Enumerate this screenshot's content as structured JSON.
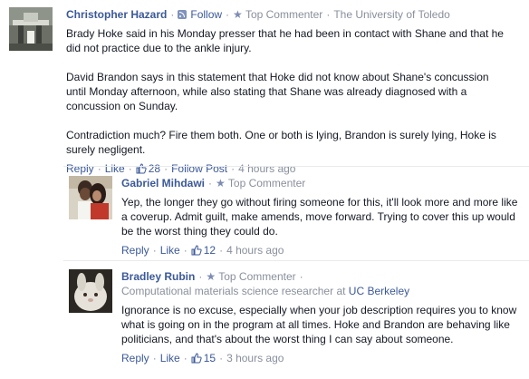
{
  "comments": [
    {
      "author": "Christopher Hazard",
      "follow_label": "Follow",
      "badge": "Top Commenter",
      "affiliation": "The University of Toledo",
      "paragraphs": [
        "Brady Hoke said in his Monday presser that he had been in contact with Shane and that he did not practice due to the ankle injury.",
        "David Brandon says in this statement that Hoke did not know about Shane's concussion until Monday afternoon, while also stating that Shane was already diagnosed with a concussion on Sunday.",
        "Contradiction much? Fire them both. One or both is lying, Brandon is surely lying, Hoke is surely negligent."
      ],
      "reply_label": "Reply",
      "like_label": "Like",
      "like_count": "28",
      "follow_post_label": "Follow Post",
      "time": "4 hours ago"
    },
    {
      "author": "Gabriel Mihdawi",
      "badge": "Top Commenter",
      "paragraphs": [
        "Yep, the longer they go without firing someone for this, it'll look more and more like a coverup. Admit guilt, make amends, move forward. Trying to cover this up would be the worst thing they could do."
      ],
      "reply_label": "Reply",
      "like_label": "Like",
      "like_count": "12",
      "time": "4 hours ago"
    },
    {
      "author": "Bradley Rubin",
      "badge": "Top Commenter",
      "affiliation": "Computational materials science researcher at",
      "affiliation_link": "UC Berkeley",
      "paragraphs": [
        "Ignorance is no excuse, especially when your job description requires you to know what is going on in the program at all times. Hoke and Brandon are behaving like politicians, and that's about the worst thing I can say about someone."
      ],
      "reply_label": "Reply",
      "like_label": "Like",
      "like_count": "15",
      "time": "3 hours ago"
    }
  ],
  "icons": {
    "follow": "rss-icon",
    "badge": "star-icon",
    "like": "thumbs-up-icon"
  },
  "colors": {
    "link": "#3b5998",
    "meta": "#898f9c",
    "text": "#141823"
  }
}
